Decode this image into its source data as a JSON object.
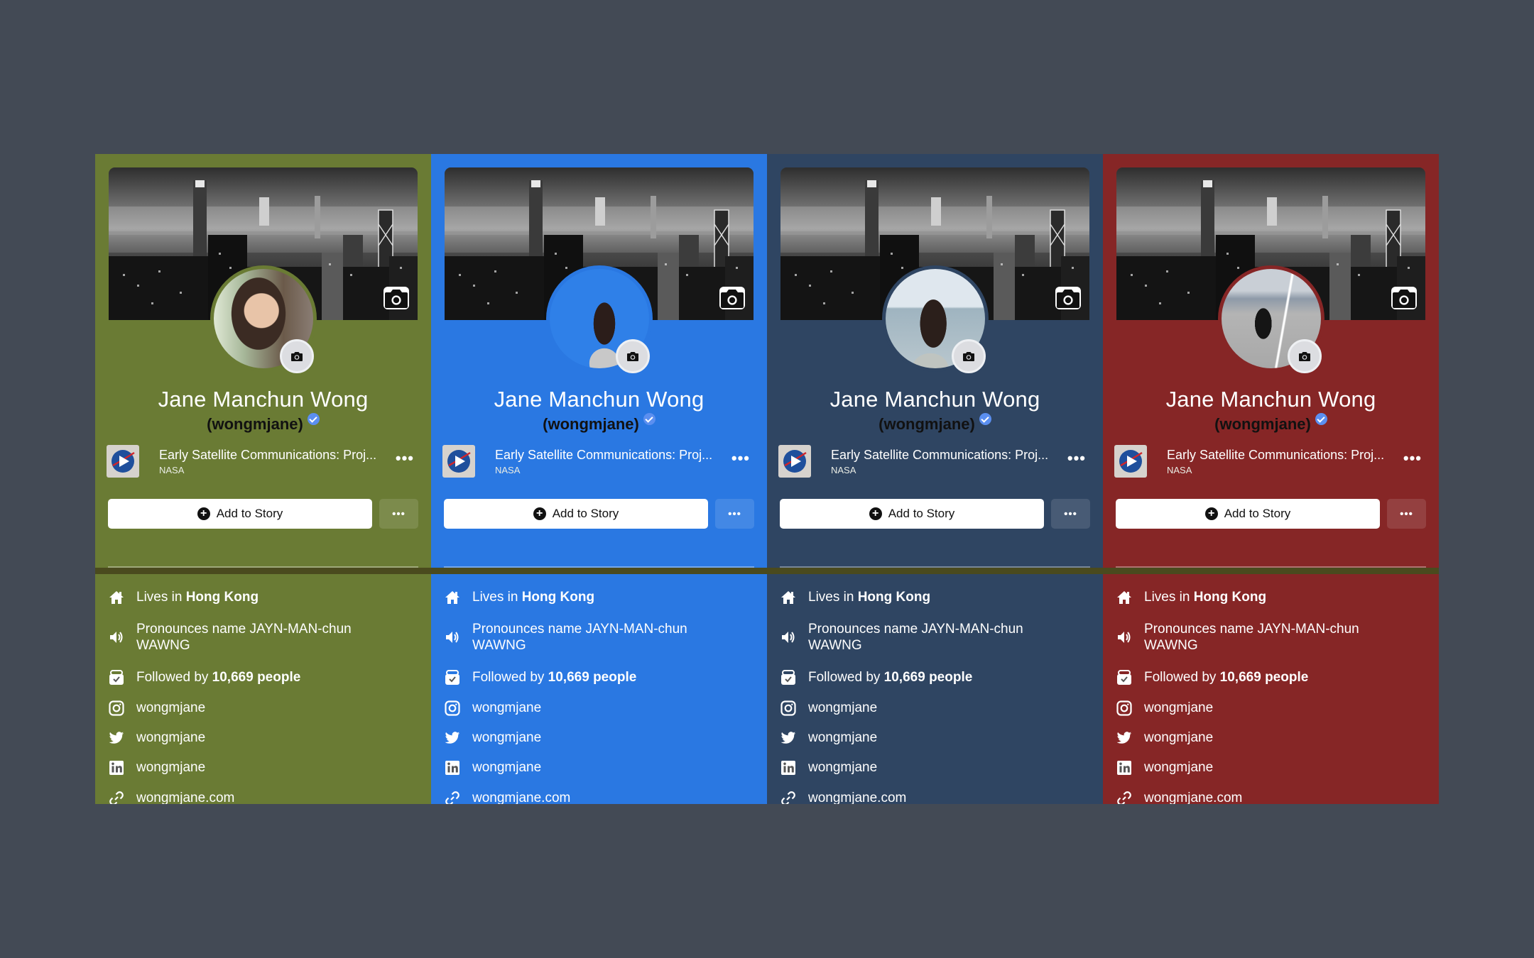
{
  "panels": [
    {
      "theme": "olive",
      "background": "#6a7b34",
      "avatar_photo": "selfie-portrait",
      "name": "Jane Manchun Wong",
      "handle": "(wongmjane)",
      "video": {
        "title": "Early Satellite Communications: Proj...",
        "channel": "NASA"
      },
      "add_story_label": "Add to Story",
      "details": {
        "lives_prefix": "Lives in ",
        "lives_city": "Hong Kong",
        "pronounce_line1": "Pronounces name JAYN-MAN-chun",
        "pronounce_line2": "WAWNG",
        "followed_prefix": "Followed by ",
        "followed_count": "10,669 people",
        "instagram": "wongmjane",
        "twitter": "wongmjane",
        "linkedin": "wongmjane",
        "website": "wongmjane.com"
      }
    },
    {
      "theme": "blue",
      "background": "#2a78e2",
      "avatar_photo": "shrug-pattern-portrait",
      "name": "Jane Manchun Wong",
      "handle": "(wongmjane)",
      "video": {
        "title": "Early Satellite Communications: Proj...",
        "channel": "NASA"
      },
      "add_story_label": "Add to Story",
      "details": {
        "lives_prefix": "Lives in ",
        "lives_city": "Hong Kong",
        "pronounce_line1": "Pronounces name JAYN-MAN-chun",
        "pronounce_line2": "WAWNG",
        "followed_prefix": "Followed by ",
        "followed_count": "10,669 people",
        "instagram": "wongmjane",
        "twitter": "wongmjane",
        "linkedin": "wongmjane",
        "website": "wongmjane.com"
      }
    },
    {
      "theme": "navy",
      "background": "#2f4562",
      "avatar_photo": "seaside-portrait",
      "name": "Jane Manchun Wong",
      "handle": "(wongmjane)",
      "video": {
        "title": "Early Satellite Communications: Proj...",
        "channel": "NASA"
      },
      "add_story_label": "Add to Story",
      "details": {
        "lives_prefix": "Lives in ",
        "lives_city": "Hong Kong",
        "pronounce_line1": "Pronounces name JAYN-MAN-chun",
        "pronounce_line2": "WAWNG",
        "followed_prefix": "Followed by ",
        "followed_count": "10,669 people",
        "instagram": "wongmjane",
        "twitter": "wongmjane",
        "linkedin": "wongmjane",
        "website": "wongmjane.com"
      }
    },
    {
      "theme": "red",
      "background": "#862626",
      "avatar_photo": "street-portrait",
      "name": "Jane Manchun Wong",
      "handle": "(wongmjane)",
      "video": {
        "title": "Early Satellite Communications: Proj...",
        "channel": "NASA"
      },
      "add_story_label": "Add to Story",
      "details": {
        "lives_prefix": "Lives in ",
        "lives_city": "Hong Kong",
        "pronounce_line1": "Pronounces name JAYN-MAN-chun",
        "pronounce_line2": "WAWNG",
        "followed_prefix": "Followed by ",
        "followed_count": "10,669 people",
        "instagram": "wongmjane",
        "twitter": "wongmjane",
        "linkedin": "wongmjane",
        "website": "wongmjane.com"
      }
    }
  ],
  "colors": {
    "page_background": "#434a55",
    "verified_badge": "#5b8ff0",
    "divider_band": "#4a4a1e"
  }
}
